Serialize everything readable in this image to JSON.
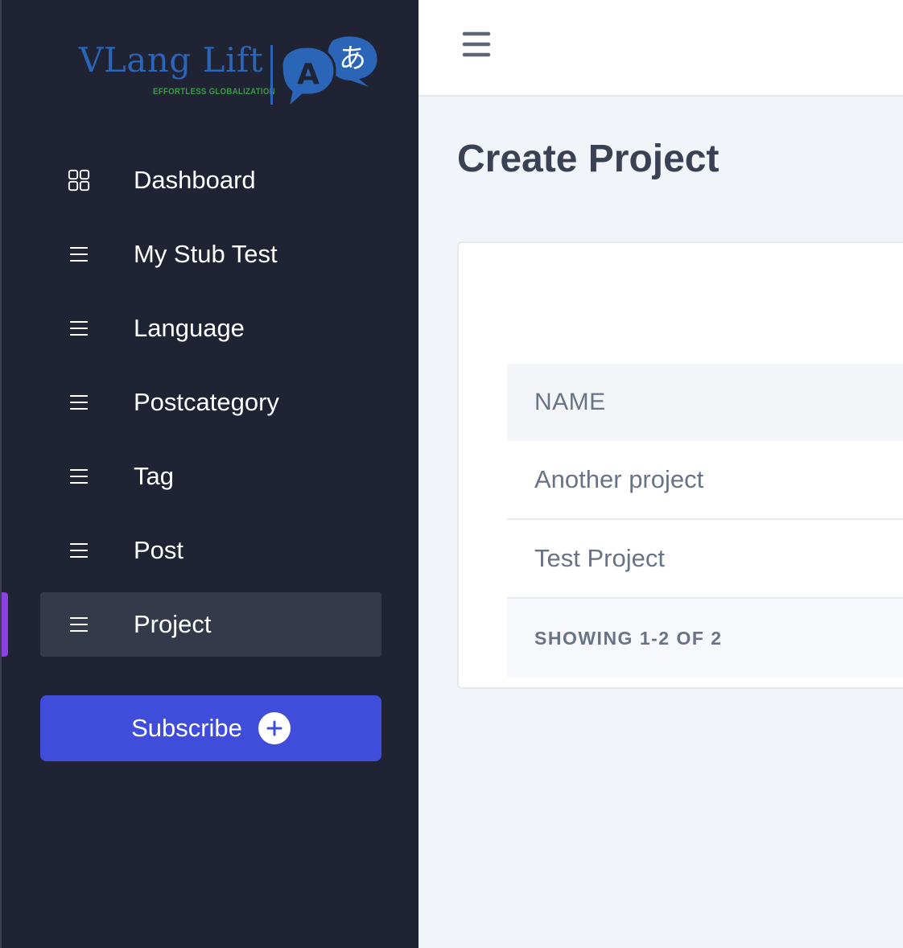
{
  "brand": {
    "name": "VLang Lift",
    "tagline": "EFFORTLESS GLOBALIZATION",
    "badge_latin": "A",
    "badge_kana": "あ",
    "colors": {
      "primary": "#2a65b8",
      "tagline": "#3d9a47"
    }
  },
  "sidebar": {
    "items": [
      {
        "label": "Dashboard",
        "icon": "grid-icon",
        "active": false
      },
      {
        "label": "My Stub Test",
        "icon": "menu-lines-icon",
        "active": false
      },
      {
        "label": "Language",
        "icon": "menu-lines-icon",
        "active": false
      },
      {
        "label": "Postcategory",
        "icon": "menu-lines-icon",
        "active": false
      },
      {
        "label": "Tag",
        "icon": "menu-lines-icon",
        "active": false
      },
      {
        "label": "Post",
        "icon": "menu-lines-icon",
        "active": false
      },
      {
        "label": "Project",
        "icon": "menu-lines-icon",
        "active": true
      }
    ],
    "subscribe": {
      "label": "Subscribe",
      "icon": "plus-circle-icon"
    },
    "colors": {
      "background": "#1f2333",
      "active": "#353a4b",
      "marker": "#8b3fe0",
      "button": "#404ddb"
    }
  },
  "header": {
    "menu_icon": "hamburger-icon"
  },
  "main": {
    "title": "Create Project",
    "table": {
      "columns": [
        "NAME"
      ],
      "rows": [
        {
          "name": "Another project"
        },
        {
          "name": "Test Project"
        }
      ],
      "footer": "SHOWING 1-2 OF 2"
    }
  }
}
